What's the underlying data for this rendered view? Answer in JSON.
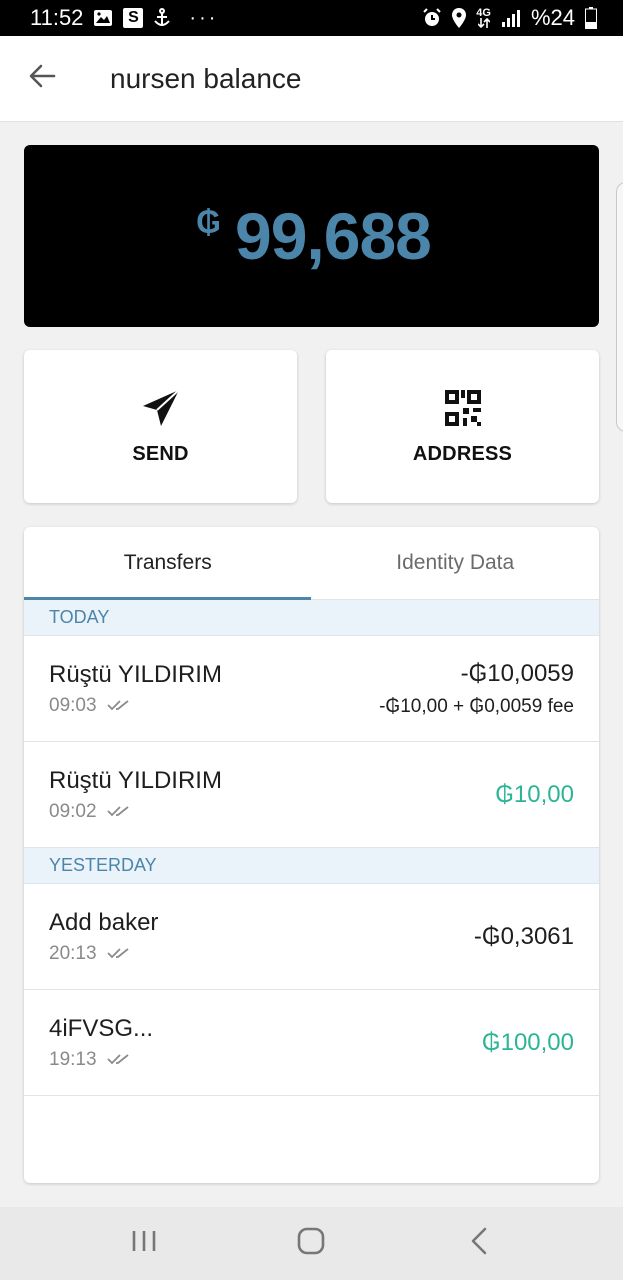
{
  "status_bar": {
    "time": "11:52",
    "battery": "%24",
    "network_top": "4G",
    "left_icons": [
      "image-icon",
      "s-app-icon",
      "anchor-icon",
      "more-dots-icon"
    ],
    "right_icons": [
      "alarm-icon",
      "location-icon",
      "network-4g-icon",
      "signal-icon",
      "battery-icon"
    ]
  },
  "app_bar": {
    "title": "nursen balance",
    "back_icon": "back-arrow-icon"
  },
  "balance": {
    "currency_symbol": "₲",
    "amount": "99,688",
    "accent_color": "#4b86aa",
    "background_color": "#000000"
  },
  "actions": {
    "send_label": "SEND",
    "send_icon": "send-paper-plane-icon",
    "address_label": "ADDRESS",
    "address_icon": "qr-code-icon"
  },
  "tabs": {
    "transfers": "Transfers",
    "identity": "Identity Data",
    "active": "Transfers"
  },
  "sections": [
    {
      "header": "TODAY",
      "transactions": [
        {
          "name": "Rüştü YILDIRIM",
          "time": "09:03",
          "amount": "-₲10,0059",
          "fee": "-₲10,00 + ₲0,0059 fee",
          "positive": false
        },
        {
          "name": "Rüştü YILDIRIM",
          "time": "09:02",
          "amount": "₲10,00",
          "fee": "",
          "positive": true
        }
      ]
    },
    {
      "header": "YESTERDAY",
      "transactions": [
        {
          "name": "Add baker",
          "time": "20:13",
          "amount": "-₲0,3061",
          "fee": "",
          "positive": false
        },
        {
          "name": "4iFVSG...",
          "time": "19:13",
          "amount": "₲100,00",
          "fee": "",
          "positive": true
        }
      ]
    }
  ],
  "colors": {
    "positive": "#2bb596",
    "accent": "#4b86aa",
    "section_header_bg": "#eaf3fa"
  },
  "nav_bar": {
    "recents_icon": "recents-icon",
    "home_icon": "home-icon",
    "back_icon": "nav-back-icon"
  }
}
